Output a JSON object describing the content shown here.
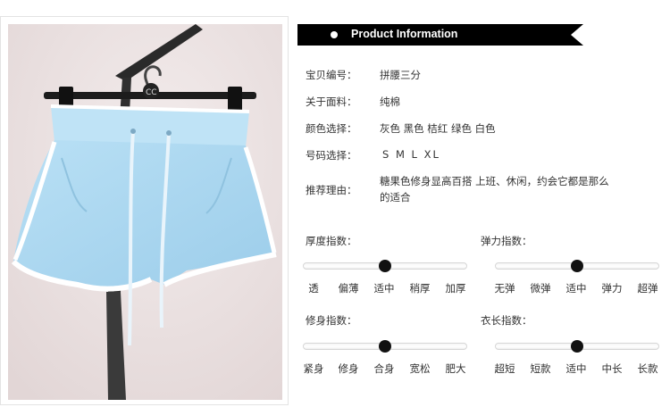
{
  "header": {
    "title": "Product Information"
  },
  "info": [
    {
      "label": "宝贝编号：",
      "value": "拼腰三分"
    },
    {
      "label": "关于面料：",
      "value": "纯棉"
    },
    {
      "label": "颜色选择：",
      "value": "灰色 黑色 桔红 绿色 白色"
    },
    {
      "label": "号码选择：",
      "value": "S M L XL"
    },
    {
      "label": "推荐理由：",
      "value_line1": "糖果色修身显高百搭 上班、休闲，约会它都是那么",
      "value_line2": "的适合"
    }
  ],
  "scales": {
    "thickness": {
      "label": "厚度指数：",
      "options": [
        "透",
        "偏薄",
        "适中",
        "稍厚",
        "加厚"
      ],
      "selected": 2
    },
    "elasticity": {
      "label": "弹力指数：",
      "options": [
        "无弹",
        "微弹",
        "适中",
        "弹力",
        "超弹"
      ],
      "selected": 2
    },
    "fit": {
      "label": "修身指数：",
      "options": [
        "紧身",
        "修身",
        "合身",
        "宽松",
        "肥大"
      ],
      "selected": 2
    },
    "length": {
      "label": "衣长指数：",
      "options": [
        "超短",
        "短款",
        "适中",
        "中长",
        "长款"
      ],
      "selected": 2
    }
  },
  "colors": {
    "shorts": "#a8d6f0",
    "trim": "#ffffff",
    "banner": "#000000",
    "knob": "#111111"
  }
}
